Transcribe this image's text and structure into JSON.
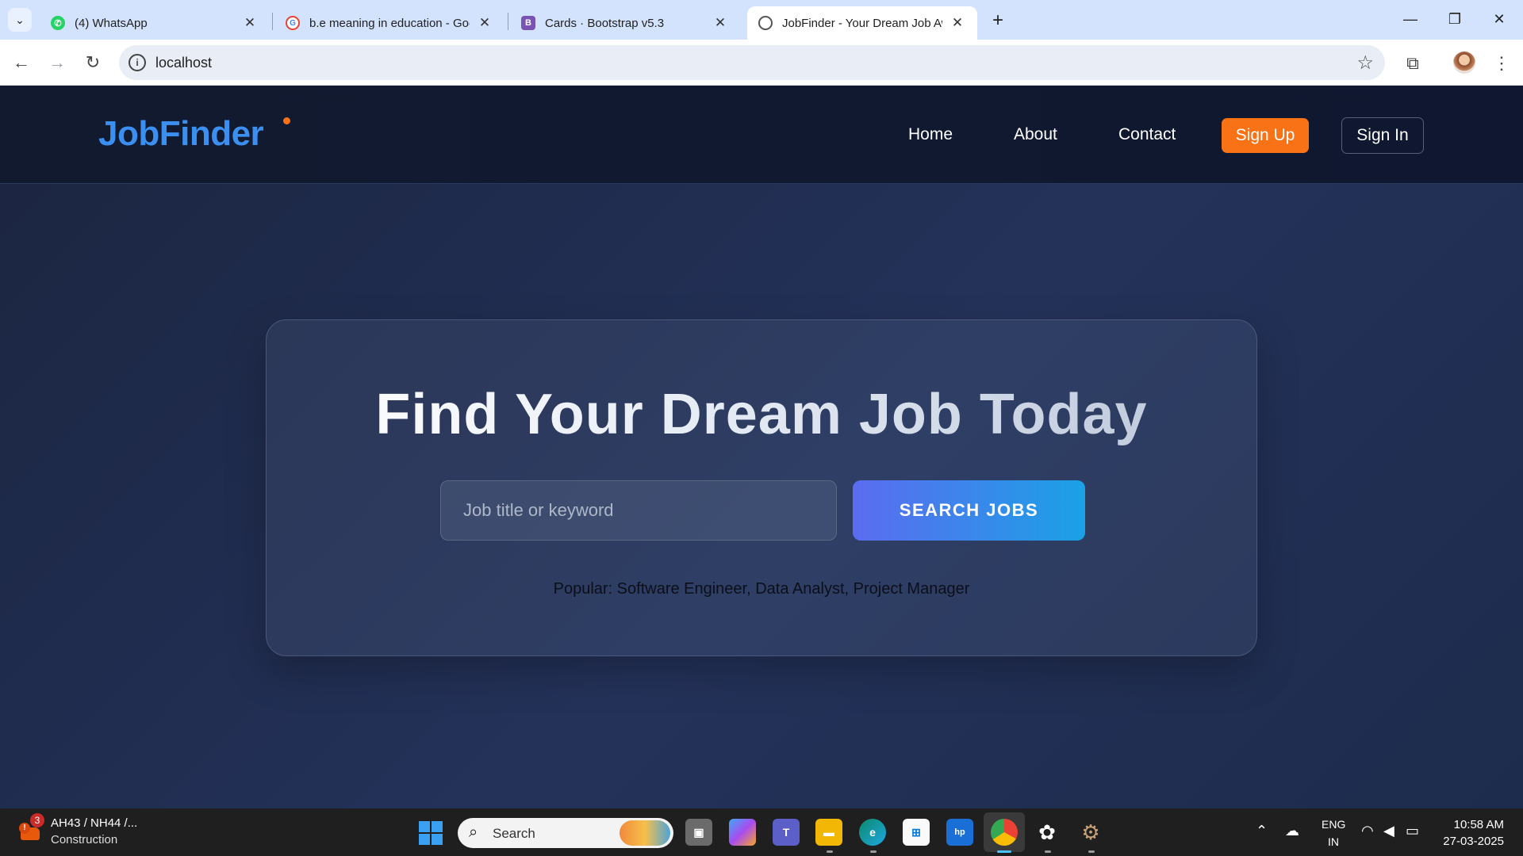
{
  "browser": {
    "tabs": [
      {
        "title": "(4) WhatsApp",
        "icon": "whatsapp-icon"
      },
      {
        "title": "b.e meaning in education - Goo",
        "icon": "google-icon"
      },
      {
        "title": "Cards · Bootstrap v5.3",
        "icon": "bootstrap-icon"
      },
      {
        "title": "JobFinder - Your Dream Job Aw",
        "icon": "globe-icon",
        "active": true
      }
    ],
    "url": "localhost"
  },
  "site": {
    "logo": "JobFinder",
    "nav": {
      "home": "Home",
      "about": "About",
      "contact": "Contact",
      "signup": "Sign Up",
      "signin": "Sign In"
    },
    "colors": {
      "accent": "#f97316",
      "logo": "#3b8ff0",
      "button_gradient_start": "#5b6cf0",
      "button_gradient_end": "#1ba1e6"
    },
    "hero": {
      "title": "Find Your Dream Job Today",
      "search_placeholder": "Job title or keyword",
      "search_value": "",
      "search_button": "SEARCH JOBS",
      "popular": "Popular: Software Engineer, Data Analyst, Project Manager"
    }
  },
  "taskbar": {
    "weather_badge": "3",
    "weather_line1": "AH43 / NH44 /...",
    "weather_line2": "Construction",
    "search_label": "Search",
    "lang_line1": "ENG",
    "lang_line2": "IN",
    "time": "10:58 AM",
    "date": "27-03-2025"
  }
}
